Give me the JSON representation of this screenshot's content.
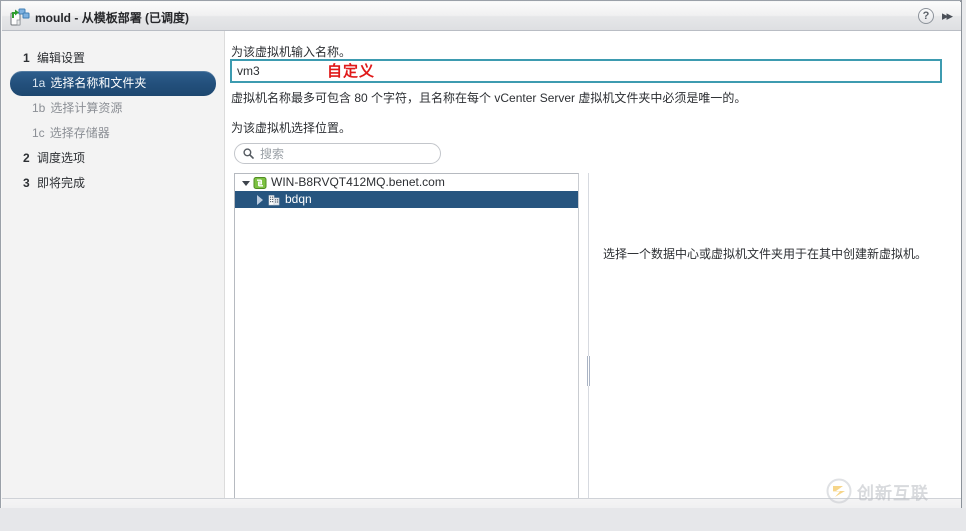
{
  "window": {
    "title_app": "mould",
    "title_dash": "-",
    "title_rest": "从模板部署 (已调度)",
    "icon": "deploy-from-template-icon",
    "help_label": "?",
    "collapse_label": "▸▸"
  },
  "sidebar": {
    "steps": [
      {
        "num": "1",
        "label": "编辑设置",
        "level": "major",
        "active": false
      },
      {
        "num": "1a",
        "label": "选择名称和文件夹",
        "level": "sub",
        "active": true
      },
      {
        "num": "1b",
        "label": "选择计算资源",
        "level": "sub",
        "active": false
      },
      {
        "num": "1c",
        "label": "选择存储器",
        "level": "sub",
        "active": false
      },
      {
        "num": "2",
        "label": "调度选项",
        "level": "major",
        "active": false
      },
      {
        "num": "3",
        "label": "即将完成",
        "level": "major",
        "active": false
      }
    ]
  },
  "main": {
    "name_label": "为该虚拟机输入名称。",
    "name_value": "vm3",
    "name_placeholder": "",
    "annotation_custom": "自定义",
    "name_hint": "虚拟机名称最多可包含 80 个字符，且名称在每个 vCenter Server 虚拟机文件夹中必须是唯一的。",
    "location_label": "为该虚拟机选择位置。",
    "search_placeholder": "搜索",
    "search_value": "",
    "tree": [
      {
        "label": "WIN-B8RVQT412MQ.benet.com",
        "icon": "vcenter-server-icon",
        "expanded": true,
        "selected": false,
        "level": 0
      },
      {
        "label": "bdqn",
        "icon": "datacenter-icon",
        "expanded": false,
        "selected": true,
        "level": 1
      }
    ],
    "info_text": "选择一个数据中心或虚拟机文件夹用于在其中创建新虚拟机。"
  },
  "watermark": {
    "text": "创新互联"
  },
  "colors": {
    "accent_selected": "#27557f",
    "input_focus_border": "#3d9bb0",
    "annotation_red": "#e01919",
    "sidebar_bg": "#f3f3f3",
    "titlebar_bg": "#f0f0f1"
  }
}
